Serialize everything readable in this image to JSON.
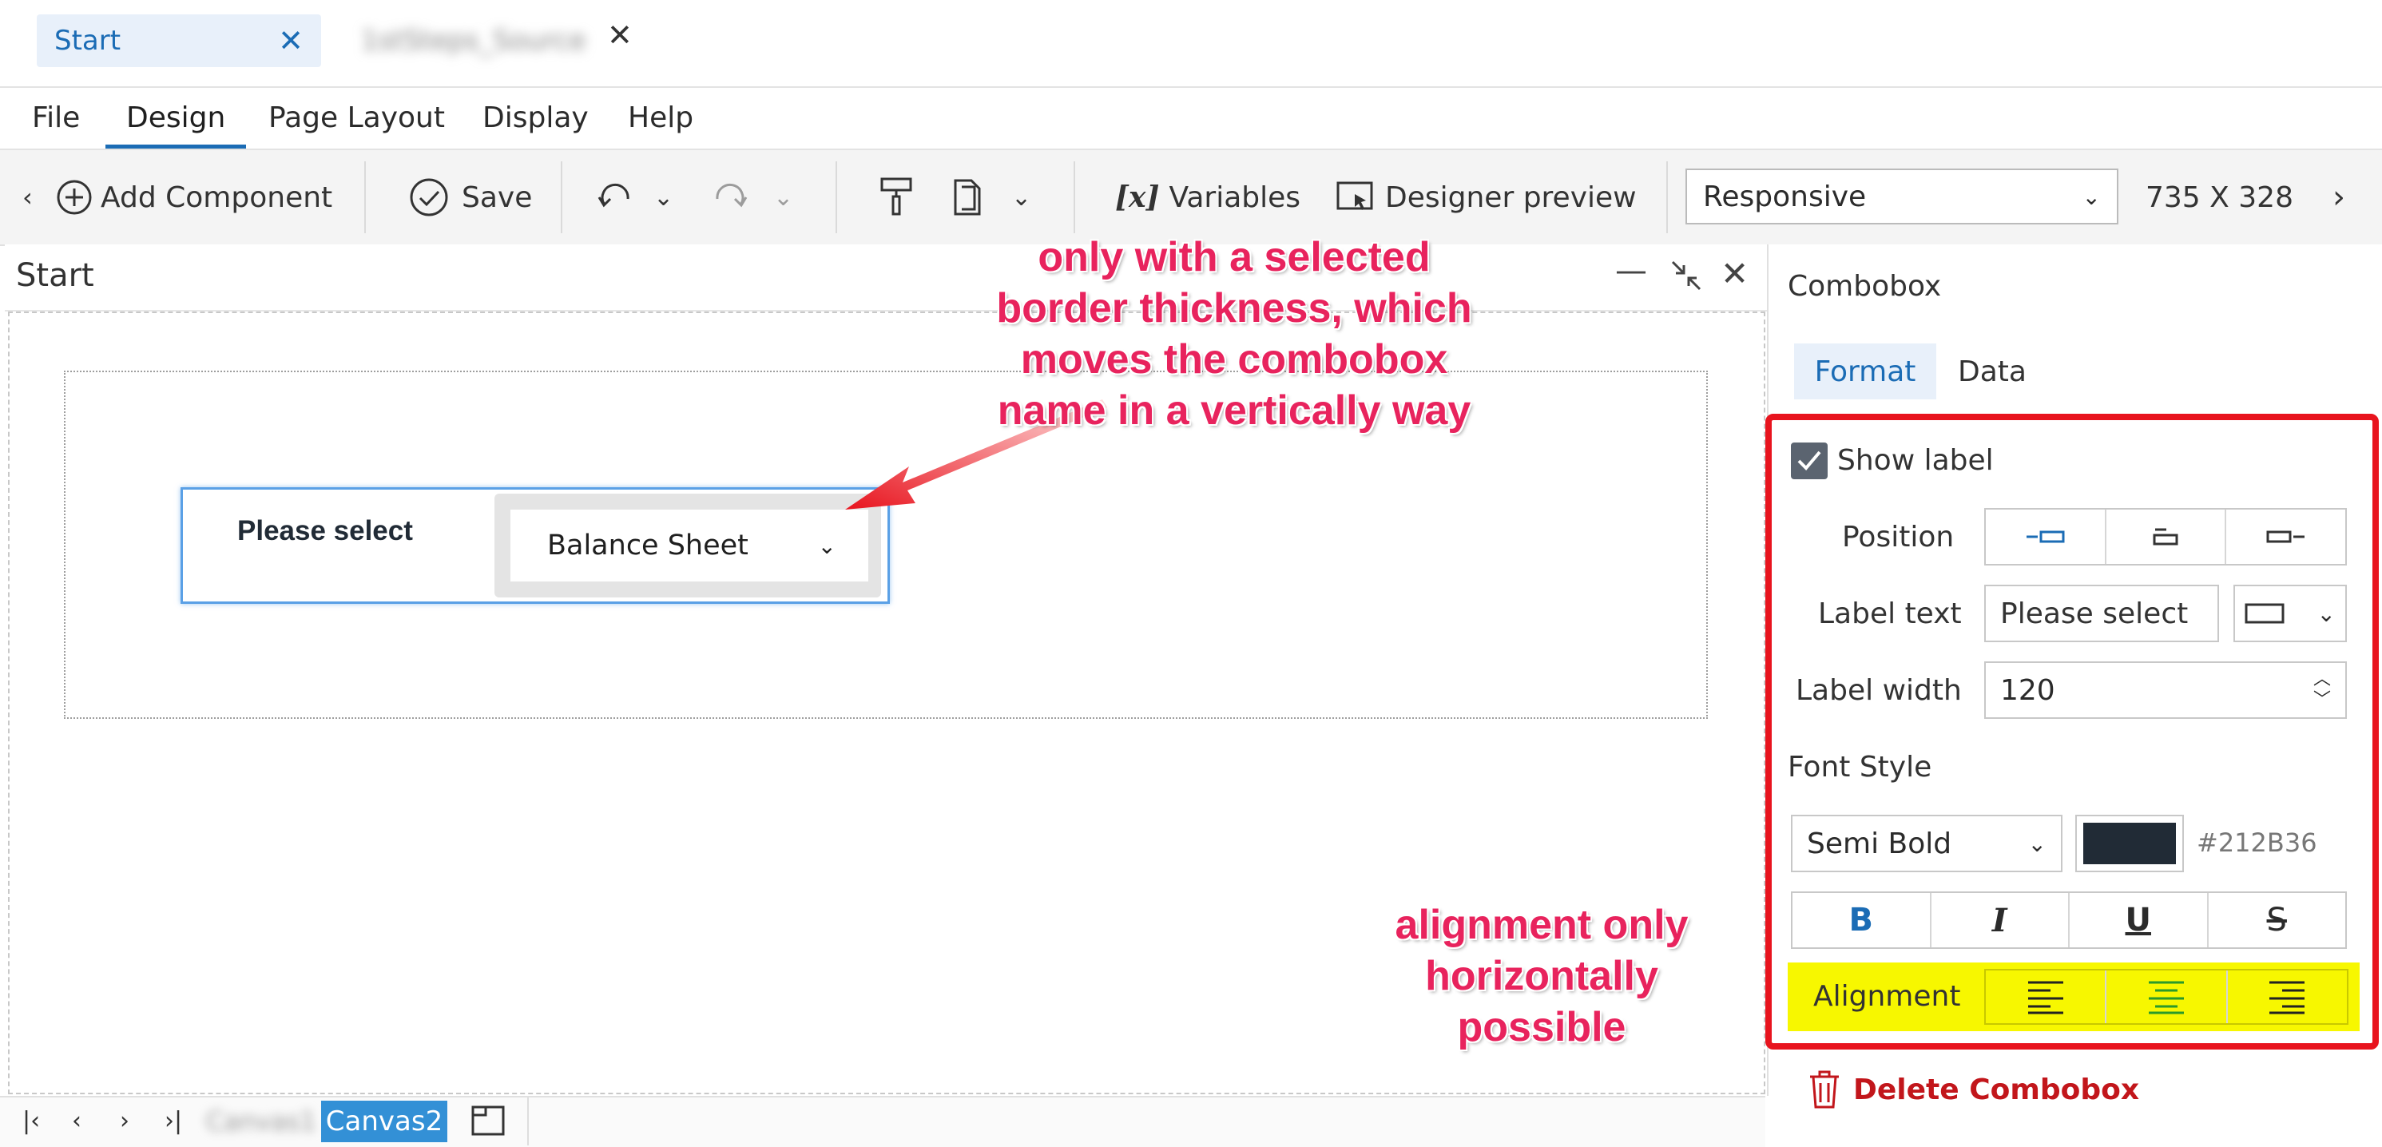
{
  "tabs": [
    {
      "label": "Start",
      "active": true
    },
    {
      "label": "1stSteps_Source",
      "active": false,
      "blurred": true
    }
  ],
  "menu": [
    "File",
    "Design",
    "Page Layout",
    "Display",
    "Help"
  ],
  "toolbar": {
    "add_component": "Add Component",
    "save": "Save",
    "variables": "Variables",
    "designer_preview": "Designer preview",
    "layout_select": "Responsive",
    "dimensions": "735  X  328"
  },
  "canvas": {
    "title": "Start",
    "combobox_label": "Please select",
    "combobox_value": "Balance Sheet"
  },
  "annotations": {
    "top_note": "only with a selected border thickness, which moves the combobox name in a vertically way",
    "bottom_note": "alignment only horizontally possible"
  },
  "bottom_bar": {
    "canvas1": "Canvas1",
    "canvas2": "Canvas2"
  },
  "properties": {
    "title": "Combobox",
    "tabs": [
      "Format",
      "Data"
    ],
    "show_label": "Show label",
    "show_label_checked": true,
    "position_label": "Position",
    "label_text_label": "Label text",
    "label_text_value": "Please select",
    "label_width_label": "Label width",
    "label_width_value": "120",
    "font_style_label": "Font Style",
    "font_weight": "Semi Bold",
    "font_color": "#212B36",
    "format_buttons": [
      "B",
      "I",
      "U",
      "S"
    ],
    "alignment_label": "Alignment",
    "delete_label": "Delete Combobox"
  },
  "colors": {
    "accent": "#1b6cb5",
    "annotation": "#e8235d",
    "highlight_box": "#e8141e",
    "alignment_highlight": "#f7f700",
    "delete": "#c2161b"
  }
}
